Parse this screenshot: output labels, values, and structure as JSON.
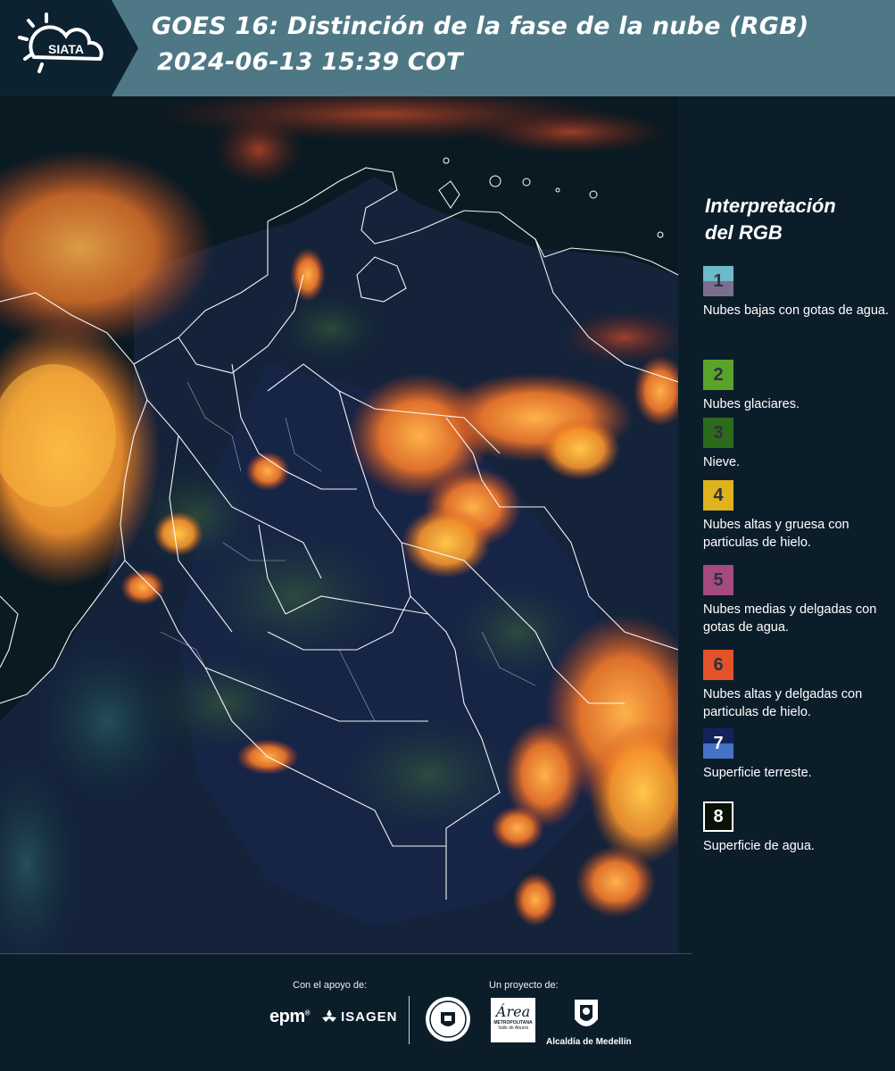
{
  "header": {
    "logo_text": "SIATA",
    "title_line1": "GOES 16: Distinción de la fase de la nube (RGB)",
    "title_line2": "2024-06-13 15:39 COT"
  },
  "legend": {
    "title_line1": "Interpretación",
    "title_line2": "del RGB",
    "items": [
      {
        "number": "1",
        "label": "Nubes bajas con gotas de agua.",
        "color_top": "#6dbbc8",
        "color_bottom": "#7b6f8e"
      },
      {
        "number": "2",
        "label": "Nubes glaciares.",
        "color_top": "#5aa32b",
        "color_bottom": "#5aa32b"
      },
      {
        "number": "3",
        "label": "Nieve.",
        "color_top": "#2c6a1c",
        "color_bottom": "#2c6a1c"
      },
      {
        "number": "4",
        "label": "Nubes altas y gruesa con particulas de hielo.",
        "color_top": "#e0b21c",
        "color_bottom": "#e0b21c"
      },
      {
        "number": "5",
        "label": "Nubes medias y delgadas con gotas de agua.",
        "color_top": "#a44a7e",
        "color_bottom": "#a44a7e"
      },
      {
        "number": "6",
        "label": "Nubes altas y delgadas con particulas de hielo.",
        "color_top": "#e5522a",
        "color_bottom": "#e5522a"
      },
      {
        "number": "7",
        "label": "Superficie terreste.",
        "color_top": "#14225c",
        "color_bottom": "#4472c4"
      },
      {
        "number": "8",
        "label": "Superficie de agua.",
        "color_top": "#0a1208",
        "color_bottom": "#0a1208"
      }
    ]
  },
  "footer": {
    "support_label": "Con el apoyo de:",
    "project_label": "Un proyecto de:",
    "epm_text": "epm",
    "isagen_text": "ISAGEN",
    "area_text": "Área",
    "area_sub": "METROPOLITANA",
    "area_sub2": "Valle de Aburrá",
    "alcaldia_text": "Alcaldía de Medellín"
  }
}
